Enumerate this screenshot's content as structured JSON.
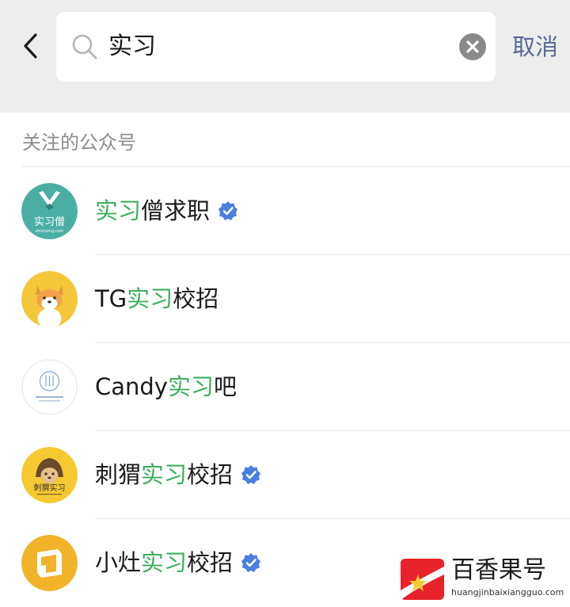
{
  "search": {
    "query": "实习",
    "cancel_label": "取消"
  },
  "section": {
    "title": "关注的公众号"
  },
  "results": [
    {
      "pre": "",
      "hl": "实习",
      "post": "僧求职",
      "verified": true,
      "avatar_text": "实习僧",
      "avatar_sub": "shixiseng.com",
      "avatar_color": "#4aaea3"
    },
    {
      "pre": "TG",
      "hl": "实习",
      "post": "校招",
      "verified": false,
      "avatar_color": "#f4c63a"
    },
    {
      "pre": "Candy",
      "hl": "实习",
      "post": "吧",
      "verified": false,
      "avatar_color": "#ffffff"
    },
    {
      "pre": "刺猬",
      "hl": "实习",
      "post": "校招",
      "verified": true,
      "avatar_text": "刺猬实习",
      "avatar_color": "#f6c832"
    },
    {
      "pre": "小灶",
      "hl": "实习",
      "post": "校招",
      "verified": true,
      "avatar_color": "#f0b32a"
    }
  ],
  "colors": {
    "highlight": "#3bb05b",
    "verified": "#4a7fe0",
    "cancel": "#576b95"
  },
  "watermark": {
    "title": "百香果号",
    "url": "huangjinbaixiangguo.com"
  }
}
